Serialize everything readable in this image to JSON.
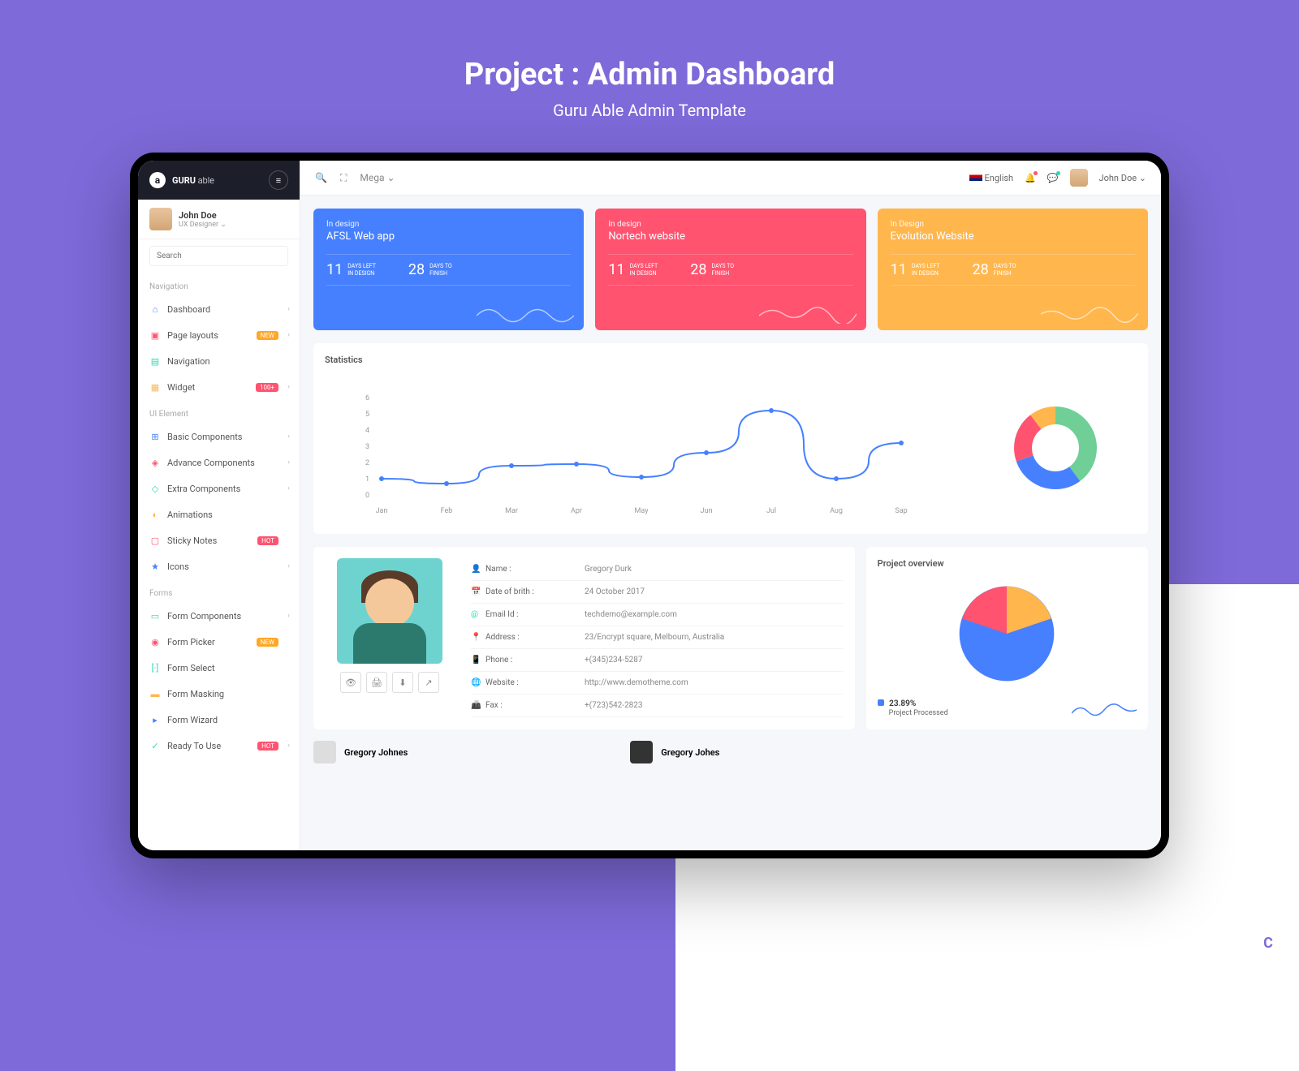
{
  "hero": {
    "title": "Project : Admin Dashboard",
    "subtitle": "Guru Able Admin Template"
  },
  "brand": {
    "name": "GURU",
    "suffix": "able"
  },
  "user": {
    "name": "John Doe",
    "role": "UX Designer"
  },
  "search": {
    "placeholder": "Search"
  },
  "topbar": {
    "mega": "Mega",
    "language": "English",
    "username": "John Doe"
  },
  "nav": {
    "section_navigation": "Navigation",
    "dashboard": "Dashboard",
    "page_layouts": "Page layouts",
    "navigation": "Navigation",
    "widget": "Widget",
    "section_ui": "UI Element",
    "basic_components": "Basic Components",
    "advance_components": "Advance Components",
    "extra_components": "Extra Components",
    "animations": "Animations",
    "sticky_notes": "Sticky Notes",
    "icons": "Icons",
    "section_forms": "Forms",
    "form_components": "Form Components",
    "form_picker": "Form Picker",
    "form_select": "Form Select",
    "form_masking": "Form Masking",
    "form_wizard": "Form Wizard",
    "ready_to_use": "Ready To Use",
    "badge_new": "NEW",
    "badge_100": "100+",
    "badge_hot": "HOT"
  },
  "cards": [
    {
      "label": "In design",
      "title": "AFSL Web app",
      "days_left": "11",
      "days_left_txt": "DAYS LEFT\nIN DESIGN",
      "days_finish": "28",
      "days_finish_txt": "DAYS TO\nFINISH"
    },
    {
      "label": "In design",
      "title": "Nortech website",
      "days_left": "11",
      "days_left_txt": "DAYS LEFT\nIN DESIGN",
      "days_finish": "28",
      "days_finish_txt": "DAYS TO\nFINISH"
    },
    {
      "label": "In Design",
      "title": "Evolution Website",
      "days_left": "11",
      "days_left_txt": "DAYS LEFT\nIN DESIGN",
      "days_finish": "28",
      "days_finish_txt": "DAYS TO\nFINISH"
    }
  ],
  "statistics": {
    "title": "Statistics"
  },
  "profile": {
    "name_label": "Name :",
    "name_value": "Gregory Durk",
    "dob_label": "Date of brith :",
    "dob_value": "24 October 2017",
    "email_label": "Email Id :",
    "email_value": "techdemo@example.com",
    "address_label": "Address :",
    "address_value": "23/Encrypt square, Melbourn, Australia",
    "phone_label": "Phone :",
    "phone_value": "+(345)234-5287",
    "website_label": "Website :",
    "website_value": "http://www.demotheme.com",
    "fax_label": "Fax :",
    "fax_value": "+(723)542-2823"
  },
  "overview": {
    "title": "Project overview",
    "percent": "23.89%",
    "processed": "Project Processed"
  },
  "bottom": {
    "name1": "Gregory Johnes",
    "name2": "Gregory Johes"
  },
  "chart_data": [
    {
      "type": "line",
      "title": "Statistics",
      "x": [
        "Jan",
        "Feb",
        "Mar",
        "Apr",
        "May",
        "Jun",
        "Jul",
        "Aug",
        "Sap"
      ],
      "values": [
        1.0,
        0.7,
        1.8,
        1.9,
        1.1,
        2.6,
        5.2,
        1.0,
        3.2
      ],
      "ylim": [
        0,
        6
      ]
    },
    {
      "type": "pie",
      "title": "Statistics Donut",
      "series": [
        {
          "name": "Green",
          "value": 40
        },
        {
          "name": "Blue",
          "value": 30
        },
        {
          "name": "Pink",
          "value": 20
        },
        {
          "name": "Orange",
          "value": 10
        }
      ]
    },
    {
      "type": "pie",
      "title": "Project overview",
      "series": [
        {
          "name": "Blue",
          "value": 60
        },
        {
          "name": "Pink",
          "value": 20
        },
        {
          "name": "Orange",
          "value": 20
        }
      ]
    }
  ]
}
